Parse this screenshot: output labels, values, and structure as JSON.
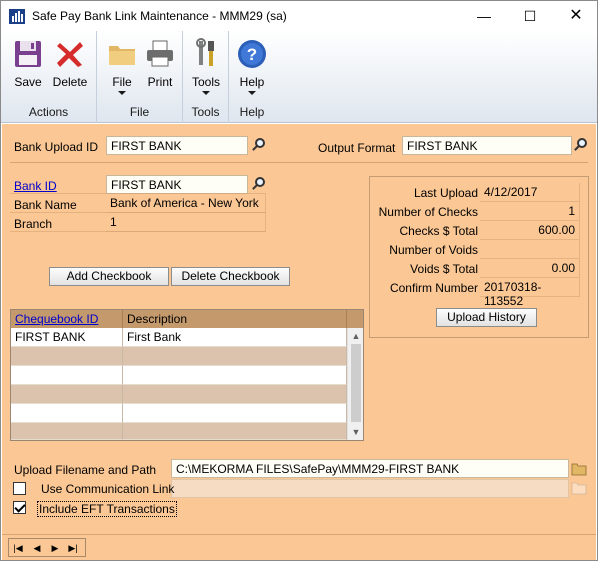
{
  "window": {
    "title": "Safe Pay Bank Link Maintenance  -  MMM29 (sa)",
    "minimize_glyph": "—",
    "maximize_glyph": "☐",
    "close_glyph": "✕"
  },
  "ribbon": {
    "groups": [
      {
        "label": "Actions",
        "buttons": [
          {
            "label": "Save",
            "icon": "save-disk-icon"
          },
          {
            "label": "Delete",
            "icon": "delete-x-icon"
          }
        ]
      },
      {
        "label": "File",
        "buttons": [
          {
            "label": "File",
            "icon": "folder-icon"
          },
          {
            "label": "Print",
            "icon": "printer-icon"
          }
        ]
      },
      {
        "label": "Tools",
        "buttons": [
          {
            "label": "Tools",
            "icon": "tools-icon"
          }
        ]
      },
      {
        "label": "Help",
        "buttons": [
          {
            "label": "Help",
            "icon": "help-question-icon"
          }
        ]
      }
    ]
  },
  "form": {
    "bank_upload_id_label": "Bank Upload ID",
    "bank_upload_id_value": "FIRST BANK",
    "output_format_label": "Output Format",
    "output_format_value": "FIRST BANK",
    "bank_id_label": "Bank ID",
    "bank_id_value": "FIRST BANK",
    "bank_name_label": "Bank Name",
    "bank_name_value": "Bank of America - New York",
    "branch_label": "Branch",
    "branch_value": "1",
    "add_checkbook_label": "Add Checkbook",
    "delete_checkbook_label": "Delete Checkbook"
  },
  "stats": {
    "rows": [
      {
        "label": "Last Upload",
        "value": "4/12/2017"
      },
      {
        "label": "Number of Checks",
        "value": "1"
      },
      {
        "label": "Checks $ Total",
        "value": "600.00"
      },
      {
        "label": "Number of Voids",
        "value": ""
      },
      {
        "label": "Voids $ Total",
        "value": "0.00"
      },
      {
        "label": "Confirm Number",
        "value": "20170318-113552"
      }
    ],
    "upload_history_label": "Upload History"
  },
  "grid": {
    "columns": [
      "Chequebook ID",
      "Description"
    ],
    "rows": [
      [
        "FIRST BANK",
        "First Bank"
      ],
      [
        "",
        ""
      ],
      [
        "",
        ""
      ],
      [
        "",
        ""
      ],
      [
        "",
        ""
      ],
      [
        "",
        ""
      ]
    ]
  },
  "upload": {
    "filename_label": "Upload Filename and Path",
    "filename_value": "C:\\MEKORMA FILES\\SafePay\\MMM29-FIRST BANK",
    "use_comm_link_label": "Use Communication Link",
    "use_comm_link_checked": false,
    "include_eft_label": "Include EFT Transactions",
    "include_eft_checked": true
  },
  "statusbar": {
    "nav": [
      "|◀",
      "◀",
      "▶",
      "▶|"
    ]
  }
}
